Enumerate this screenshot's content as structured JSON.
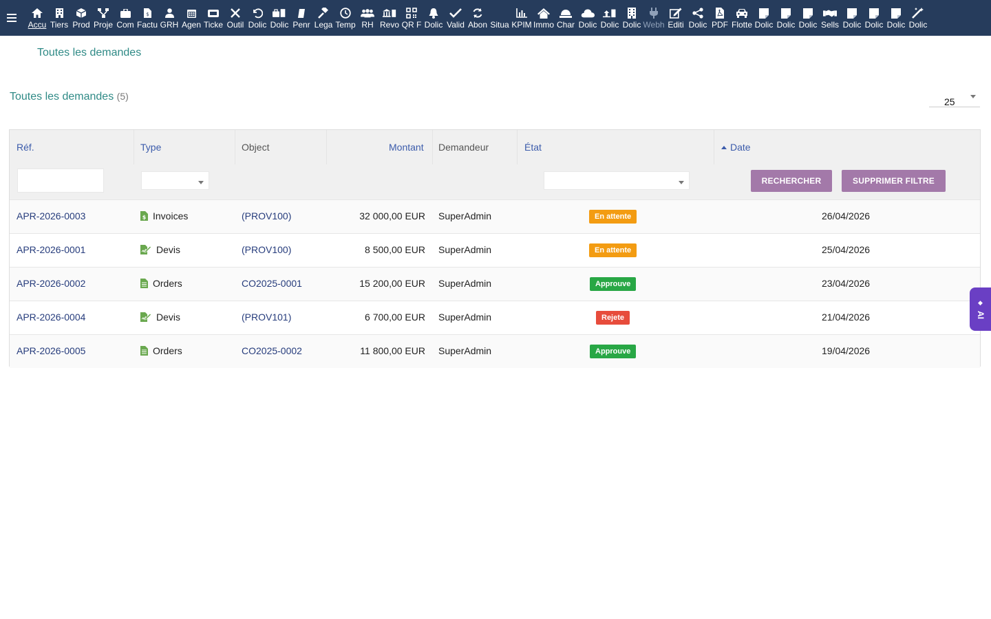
{
  "topbar": {
    "menu_items": [
      {
        "label": "Accu",
        "icon": "home-icon",
        "active": true
      },
      {
        "label": "Tiers",
        "icon": "building-icon"
      },
      {
        "label": "Prod",
        "icon": "cube-icon"
      },
      {
        "label": "Proje",
        "icon": "sitemap-icon"
      },
      {
        "label": "Com",
        "icon": "briefcase-icon"
      },
      {
        "label": "Factu",
        "icon": "invoice-icon"
      },
      {
        "label": "GRH",
        "icon": "user-tie-icon"
      },
      {
        "label": "Agen",
        "icon": "calendar-icon"
      },
      {
        "label": "Ticke",
        "icon": "ticket-icon"
      },
      {
        "label": "Outil",
        "icon": "tools-icon"
      },
      {
        "label": "Dolic",
        "icon": "undo-icon"
      },
      {
        "label": "Dolic",
        "icon": "toolbox-icon"
      },
      {
        "label": "Penr",
        "icon": "bookmark-icon"
      },
      {
        "label": "Lega",
        "icon": "gavel-icon"
      },
      {
        "label": "Temp",
        "icon": "clock-icon"
      },
      {
        "label": "RH",
        "icon": "users-icon"
      },
      {
        "label": "Revo",
        "icon": "bank-icon"
      },
      {
        "label": "QR F",
        "icon": "qrcode-icon"
      },
      {
        "label": "Dolic",
        "icon": "bell-icon"
      },
      {
        "label": "Valid",
        "icon": "double-check-icon"
      },
      {
        "label": "Abon",
        "icon": "sync-icon"
      },
      {
        "label": "Situa",
        "icon": "blank-icon"
      },
      {
        "label": "KPIM",
        "icon": "chart-icon"
      },
      {
        "label": "Immo",
        "icon": "house-icon"
      },
      {
        "label": "Char",
        "icon": "cloud-dome-icon"
      },
      {
        "label": "Dolic",
        "icon": "cloud-icon"
      },
      {
        "label": "Dolic",
        "icon": "upload-icon"
      },
      {
        "label": "Dolic",
        "icon": "office-icon"
      },
      {
        "label": "Webh",
        "icon": "plug-icon",
        "dim": true
      },
      {
        "label": "Editi",
        "icon": "edit-icon"
      },
      {
        "label": "Dolic",
        "icon": "share-icon"
      },
      {
        "label": "PDF",
        "icon": "pdf-icon"
      },
      {
        "label": "Flotte",
        "icon": "car-icon"
      },
      {
        "label": "Dolic",
        "icon": "note-icon"
      },
      {
        "label": "Dolic",
        "icon": "note-icon"
      },
      {
        "label": "Dolic",
        "icon": "note-icon"
      },
      {
        "label": "Sells",
        "icon": "handshake-icon"
      },
      {
        "label": "Dolic",
        "icon": "note-icon"
      },
      {
        "label": "Dolic",
        "icon": "note-icon"
      },
      {
        "label": "Dolic",
        "icon": "note-icon"
      },
      {
        "label": "Dolic",
        "icon": "magic-icon"
      }
    ]
  },
  "breadcrumb": "Toutes les demandes",
  "list": {
    "title": "Toutes les demandes",
    "count": "(5)",
    "limit": "25"
  },
  "table": {
    "headers": {
      "ref": "Réf.",
      "type": "Type",
      "object": "Object",
      "amount": "Montant",
      "requester": "Demandeur",
      "state": "État",
      "date": "Date"
    },
    "filters": {
      "ref_value": "",
      "type_value": "",
      "state_value": "",
      "search_label": "RECHERCHER",
      "clear_label": "SUPPRIMER FILTRE"
    },
    "rows": [
      {
        "ref": "APR-2026-0003",
        "type": "Invoices",
        "type_icon": "invoice-file-icon",
        "object": "(PROV100)",
        "amount": "32 000,00 EUR",
        "requester": "SuperAdmin",
        "state": "En attente",
        "state_kind": "pending",
        "date": "26/04/2026"
      },
      {
        "ref": "APR-2026-0001",
        "type": "Devis",
        "type_icon": "signature-file-icon",
        "object": "(PROV100)",
        "amount": "8 500,00 EUR",
        "requester": "SuperAdmin",
        "state": "En attente",
        "state_kind": "pending",
        "date": "25/04/2026"
      },
      {
        "ref": "APR-2026-0002",
        "type": "Orders",
        "type_icon": "order-file-icon",
        "object": "CO2025-0001",
        "amount": "15 200,00 EUR",
        "requester": "SuperAdmin",
        "state": "Approuve",
        "state_kind": "approved",
        "date": "23/04/2026"
      },
      {
        "ref": "APR-2026-0004",
        "type": "Devis",
        "type_icon": "signature-file-icon",
        "object": "(PROV101)",
        "amount": "6 700,00 EUR",
        "requester": "SuperAdmin",
        "state": "Rejete",
        "state_kind": "rejected",
        "date": "21/04/2026"
      },
      {
        "ref": "APR-2026-0005",
        "type": "Orders",
        "type_icon": "order-file-icon",
        "object": "CO2025-0002",
        "amount": "11 800,00 EUR",
        "requester": "SuperAdmin",
        "state": "Approuve",
        "state_kind": "approved",
        "date": "19/04/2026"
      }
    ]
  },
  "ai_tab": {
    "label": "AI",
    "icon": "diamond-icon"
  },
  "colors": {
    "topbar": "#263c5c",
    "teal": "#2f8a86",
    "button": "#a379a9",
    "pending": "#f39c12",
    "approved": "#28a745",
    "rejected": "#e74c3c",
    "ai": "#6a3fc4"
  }
}
